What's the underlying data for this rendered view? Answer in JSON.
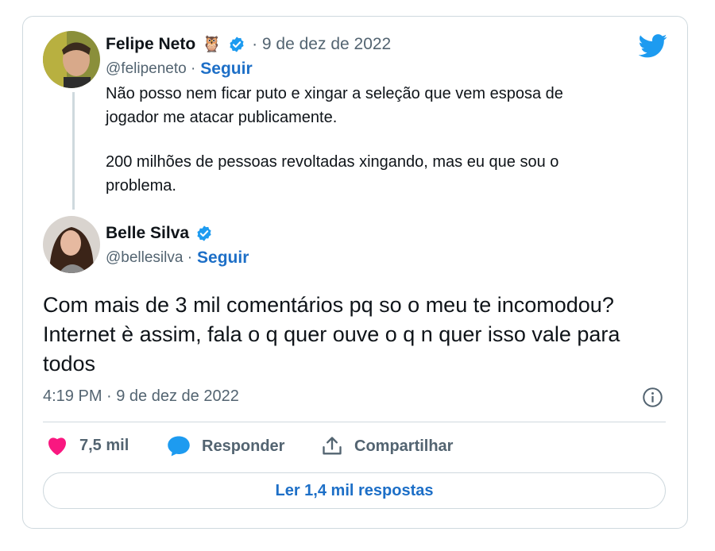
{
  "tweet_parent": {
    "author_name": "Felipe Neto",
    "author_emoji": "🦉",
    "date": "· 9 de dez de 2022",
    "handle": "@felipeneto ·",
    "follow_label": "Seguir",
    "text_line1": "Não posso nem ficar puto e xingar a seleção que vem esposa de",
    "text_line2": "jogador me atacar publicamente.",
    "text_line3": "200 milhões de pessoas revoltadas xingando, mas eu que sou o",
    "text_line4": "problema."
  },
  "tweet_reply": {
    "author_name": "Belle Silva",
    "handle": "@bellesilva ·",
    "follow_label": "Seguir",
    "text_line1": "Com mais de 3 mil comentários pq so o meu te incomodou?",
    "text_line2": "Internet è assim, fala o q quer ouve o q n quer isso vale para",
    "text_line3": "todos",
    "timestamp": "4:19 PM · 9 de dez de 2022"
  },
  "actions": {
    "likes_count": "7,5 mil",
    "reply_label": "Responder",
    "share_label": "Compartilhar"
  },
  "read_replies_label": "Ler 1,4 mil respostas",
  "colors": {
    "accent_blue": "#1d6fc7",
    "twitter_blue": "#1d9bf0",
    "like_pink": "#f91880",
    "muted_text": "#536471",
    "border": "#cfd9de"
  },
  "icons": [
    "twitter-bird-icon",
    "verified-badge-icon",
    "heart-icon",
    "reply-bubble-icon",
    "share-icon",
    "info-icon"
  ]
}
